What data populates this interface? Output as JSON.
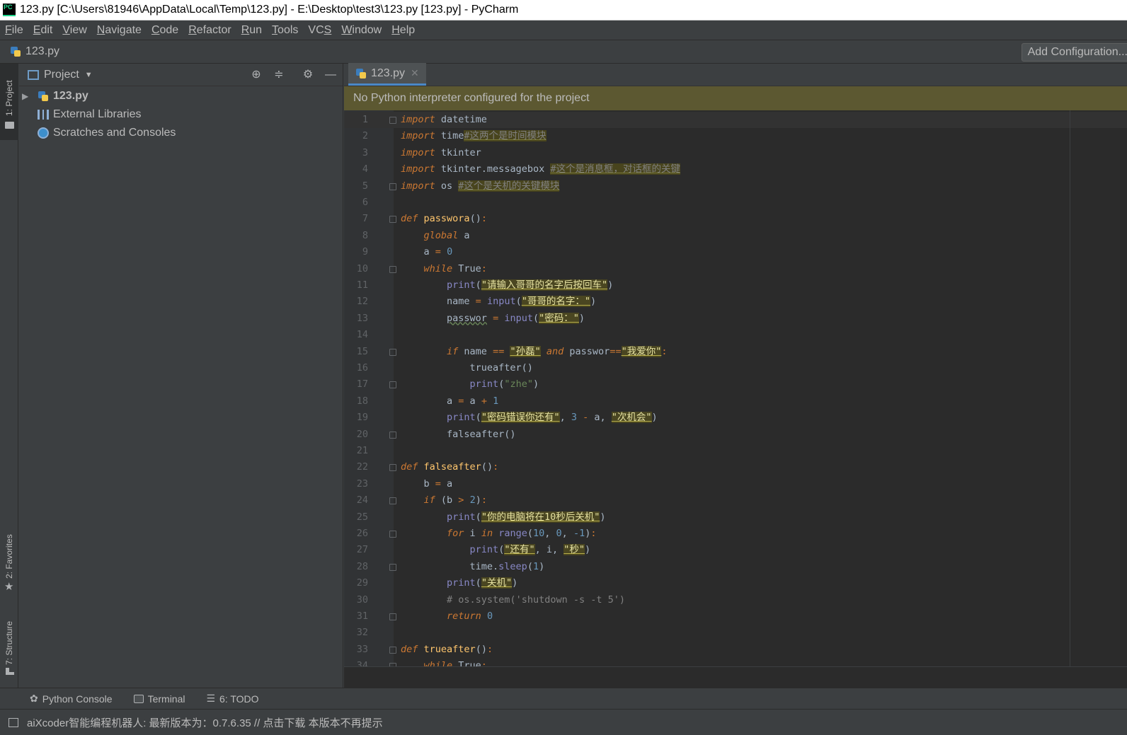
{
  "window": {
    "title": "123.py [C:\\Users\\81946\\AppData\\Local\\Temp\\123.py] - E:\\Desktop\\test3\\123.py [123.py] - PyCharm",
    "logo_text": "PC"
  },
  "menu": [
    "File",
    "Edit",
    "View",
    "Navigate",
    "Code",
    "Refactor",
    "Run",
    "Tools",
    "VCS",
    "Window",
    "Help"
  ],
  "menu_mnemonic": [
    "F",
    "E",
    "V",
    "N",
    "C",
    "R",
    "R",
    "T",
    "S",
    "W",
    "H"
  ],
  "breadcrumb": {
    "file": "123.py",
    "add_config": "Add Configuration..."
  },
  "left_strip": {
    "project": "1: Project",
    "favorites": "2: Favorites",
    "structure": "7: Structure"
  },
  "project_panel": {
    "title": "Project",
    "items": [
      {
        "label": "123.py"
      },
      {
        "label": "External Libraries"
      },
      {
        "label": "Scratches and Consoles"
      }
    ]
  },
  "editor": {
    "tab_label": "123.py",
    "warning": "No Python interpreter configured for the project",
    "current_line": 1
  },
  "code": [
    [
      [
        "kw",
        "import"
      ],
      [
        "p",
        " datetime"
      ]
    ],
    [
      [
        "kw",
        "import"
      ],
      [
        "p",
        " time"
      ],
      [
        "cmw",
        "#这两个是时间模块"
      ]
    ],
    [
      [
        "kw",
        "import"
      ],
      [
        "p",
        " tkinter"
      ]
    ],
    [
      [
        "kw",
        "import"
      ],
      [
        "p",
        " tkinter.messagebox "
      ],
      [
        "cmw",
        "#这个是消息框，对话框的关键"
      ]
    ],
    [
      [
        "kw",
        "import"
      ],
      [
        "p",
        " os "
      ],
      [
        "cmw",
        "#这个是关机的关键模块"
      ]
    ],
    [],
    [
      [
        "kw",
        "def"
      ],
      [
        "p",
        " "
      ],
      [
        "fn",
        "passwora"
      ],
      [
        "p",
        "()"
      ],
      [
        "kw2",
        ":"
      ]
    ],
    [
      [
        "p",
        "    "
      ],
      [
        "kw",
        "global"
      ],
      [
        "p",
        " a"
      ]
    ],
    [
      [
        "p",
        "    a "
      ],
      [
        "kw2",
        "="
      ],
      [
        "p",
        " "
      ],
      [
        "nm",
        "0"
      ]
    ],
    [
      [
        "p",
        "    "
      ],
      [
        "kw",
        "while"
      ],
      [
        "p",
        " True"
      ],
      [
        "kw2",
        ":"
      ]
    ],
    [
      [
        "p",
        "        "
      ],
      [
        "bi",
        "print"
      ],
      [
        "p",
        "("
      ],
      [
        "sw",
        "\"请输入哥哥的名字后按回车\""
      ],
      [
        "p",
        ")"
      ]
    ],
    [
      [
        "p",
        "        name "
      ],
      [
        "kw2",
        "="
      ],
      [
        "p",
        " "
      ],
      [
        "bi",
        "input"
      ],
      [
        "p",
        "("
      ],
      [
        "sw",
        "\"哥哥的名字：\""
      ],
      [
        "p",
        ")"
      ]
    ],
    [
      [
        "p",
        "        "
      ],
      [
        "wv",
        "passwor"
      ],
      [
        "p",
        " "
      ],
      [
        "kw2",
        "="
      ],
      [
        "p",
        " "
      ],
      [
        "bi",
        "input"
      ],
      [
        "p",
        "("
      ],
      [
        "sw",
        "\"密码：\""
      ],
      [
        "p",
        ")"
      ]
    ],
    [],
    [
      [
        "p",
        "        "
      ],
      [
        "kw",
        "if"
      ],
      [
        "p",
        " name "
      ],
      [
        "kw2",
        "=="
      ],
      [
        "p",
        " "
      ],
      [
        "sw",
        "\"孙磊\""
      ],
      [
        "p",
        " "
      ],
      [
        "kw",
        "and"
      ],
      [
        "p",
        " passwor"
      ],
      [
        "kw2",
        "=="
      ],
      [
        "sw",
        "\"我爱你\""
      ],
      [
        "kw2",
        ":"
      ]
    ],
    [
      [
        "p",
        "            trueafter()"
      ]
    ],
    [
      [
        "p",
        "            "
      ],
      [
        "bi",
        "print"
      ],
      [
        "p",
        "("
      ],
      [
        "st",
        "\"zhe\""
      ],
      [
        "p",
        ")"
      ]
    ],
    [
      [
        "p",
        "        a "
      ],
      [
        "kw2",
        "="
      ],
      [
        "p",
        " a "
      ],
      [
        "kw2",
        "+"
      ],
      [
        "p",
        " "
      ],
      [
        "nm",
        "1"
      ]
    ],
    [
      [
        "p",
        "        "
      ],
      [
        "bi",
        "print"
      ],
      [
        "p",
        "("
      ],
      [
        "sw",
        "\"密码错误你还有\""
      ],
      [
        "p",
        ", "
      ],
      [
        "nm",
        "3"
      ],
      [
        "p",
        " "
      ],
      [
        "kw2",
        "-"
      ],
      [
        "p",
        " a, "
      ],
      [
        "sw",
        "\"次机会\""
      ],
      [
        "p",
        ")"
      ]
    ],
    [
      [
        "p",
        "        falseafter()"
      ]
    ],
    [],
    [
      [
        "kw",
        "def"
      ],
      [
        "p",
        " "
      ],
      [
        "fn",
        "falseafter"
      ],
      [
        "p",
        "()"
      ],
      [
        "kw2",
        ":"
      ]
    ],
    [
      [
        "p",
        "    b "
      ],
      [
        "kw2",
        "="
      ],
      [
        "p",
        " a"
      ]
    ],
    [
      [
        "p",
        "    "
      ],
      [
        "kw",
        "if"
      ],
      [
        "p",
        " (b "
      ],
      [
        "kw2",
        ">"
      ],
      [
        "p",
        " "
      ],
      [
        "nm",
        "2"
      ],
      [
        "p",
        ")"
      ],
      [
        "kw2",
        ":"
      ]
    ],
    [
      [
        "p",
        "        "
      ],
      [
        "bi",
        "print"
      ],
      [
        "p",
        "("
      ],
      [
        "sw",
        "\"你的电脑将在10秒后关机\""
      ],
      [
        "p",
        ")"
      ]
    ],
    [
      [
        "p",
        "        "
      ],
      [
        "kw",
        "for"
      ],
      [
        "p",
        " i "
      ],
      [
        "kw",
        "in"
      ],
      [
        "p",
        " "
      ],
      [
        "bi",
        "range"
      ],
      [
        "p",
        "("
      ],
      [
        "nm",
        "10"
      ],
      [
        "p",
        ", "
      ],
      [
        "nm",
        "0"
      ],
      [
        "p",
        ", "
      ],
      [
        "nm",
        "-1"
      ],
      [
        "p",
        ")"
      ],
      [
        "kw2",
        ":"
      ]
    ],
    [
      [
        "p",
        "            "
      ],
      [
        "bi",
        "print"
      ],
      [
        "p",
        "("
      ],
      [
        "sw",
        "\"还有\""
      ],
      [
        "p",
        ", i, "
      ],
      [
        "sw",
        "\"秒\""
      ],
      [
        "p",
        ")"
      ]
    ],
    [
      [
        "p",
        "            time."
      ],
      [
        "bi",
        "sleep"
      ],
      [
        "p",
        "("
      ],
      [
        "nm",
        "1"
      ],
      [
        "p",
        ")"
      ]
    ],
    [
      [
        "p",
        "        "
      ],
      [
        "bi",
        "print"
      ],
      [
        "p",
        "("
      ],
      [
        "sw",
        "\"关机\""
      ],
      [
        "p",
        ")"
      ]
    ],
    [
      [
        "p",
        "        "
      ],
      [
        "cm",
        "# os.system('shutdown -s -t 5')"
      ]
    ],
    [
      [
        "p",
        "        "
      ],
      [
        "kw",
        "return"
      ],
      [
        "p",
        " "
      ],
      [
        "nm",
        "0"
      ]
    ],
    [],
    [
      [
        "kw",
        "def"
      ],
      [
        "p",
        " "
      ],
      [
        "fn",
        "trueafter"
      ],
      [
        "p",
        "()"
      ],
      [
        "kw2",
        ":"
      ]
    ],
    [
      [
        "p",
        "    "
      ],
      [
        "kw",
        "while"
      ],
      [
        "p",
        " True"
      ],
      [
        "kw2",
        ":"
      ]
    ]
  ],
  "fold_lines": [
    1,
    5,
    7,
    10,
    15,
    17,
    20,
    22,
    24,
    26,
    28,
    31,
    33,
    34
  ],
  "bottom_tabs": [
    {
      "label": "Python Console",
      "icon": "python-icon"
    },
    {
      "label": "Terminal",
      "icon": "terminal-icon"
    },
    {
      "label": "6: TODO",
      "icon": "todo-list-icon"
    }
  ],
  "status": {
    "message": "aiXcoder智能编程机器人: 最新版本为：0.7.6.35 // 点击下载 本版本不再提示"
  }
}
